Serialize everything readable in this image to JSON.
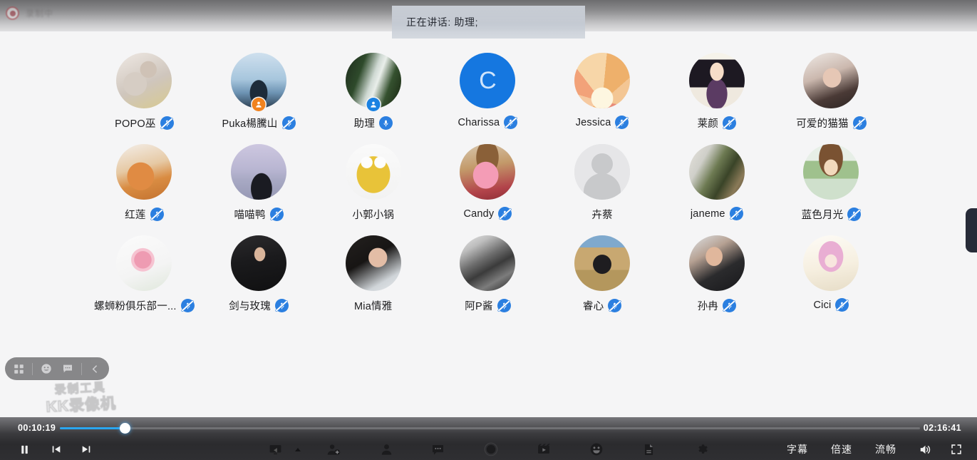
{
  "recording_chip": {
    "label": "录制中",
    "icon": "record-dot-icon"
  },
  "speaking_banner": {
    "text": "正在讲话: 助理;"
  },
  "participants": [
    {
      "name": "POPO巫",
      "mic": "muted",
      "badge": "none",
      "avatar": "cats-photo"
    },
    {
      "name": "Puka楊騰山",
      "mic": "muted",
      "badge": "host",
      "avatar": "water-drop-photo"
    },
    {
      "name": "助理",
      "mic": "on",
      "badge": "me",
      "avatar": "waterfall-photo"
    },
    {
      "name": "Charissa",
      "mic": "muted",
      "badge": "none",
      "avatar": "initial",
      "initial": "C"
    },
    {
      "name": "Jessica",
      "mic": "muted",
      "badge": "none",
      "avatar": "sunburst-art"
    },
    {
      "name": "莱颜",
      "mic": "muted",
      "badge": "none",
      "avatar": "anime-girl-dark-hair"
    },
    {
      "name": "可爱的猫猫",
      "mic": "muted",
      "badge": "none",
      "avatar": "selfie-woman-photo"
    },
    {
      "name": "红莲",
      "mic": "muted",
      "badge": "none",
      "avatar": "orange-cat-antlers"
    },
    {
      "name": "喵喵鸭",
      "mic": "muted",
      "badge": "none",
      "avatar": "person-lilac-sky"
    },
    {
      "name": "小郭小锅",
      "mic": "none",
      "badge": "none",
      "avatar": "yellow-nut-cartoon"
    },
    {
      "name": "Candy",
      "mic": "muted",
      "badge": "none",
      "avatar": "kirby-plush"
    },
    {
      "name": "卉蔡",
      "mic": "none",
      "badge": "none",
      "avatar": "default-silhouette"
    },
    {
      "name": "janeme",
      "mic": "muted",
      "badge": "none",
      "avatar": "street-scene-photo"
    },
    {
      "name": "蓝色月光",
      "mic": "muted",
      "badge": "none",
      "avatar": "anime-girl-brown-hair"
    },
    {
      "name": "螺蛳粉俱乐部一...",
      "mic": "muted",
      "badge": "none",
      "avatar": "pink-rose-photo"
    },
    {
      "name": "剑与玫瑰",
      "mic": "muted",
      "badge": "none",
      "avatar": "dark-portrait-photo"
    },
    {
      "name": "Mia情雅",
      "mic": "none",
      "badge": "none",
      "avatar": "woman-dark-bg-photo"
    },
    {
      "name": "阿P酱",
      "mic": "muted",
      "badge": "none",
      "avatar": "bw-landscape-photo"
    },
    {
      "name": "睿心",
      "mic": "muted",
      "badge": "none",
      "avatar": "woman-field-photo"
    },
    {
      "name": "孙冉",
      "mic": "muted",
      "badge": "none",
      "avatar": "man-portrait-photo"
    },
    {
      "name": "Cici",
      "mic": "muted",
      "badge": "none",
      "avatar": "anime-pink-hair"
    }
  ],
  "float_toolbar": {
    "items": [
      {
        "name": "grid-layout-icon"
      },
      {
        "name": "emoji-reaction-icon"
      },
      {
        "name": "chat-bubble-icon"
      },
      {
        "name": "collapse-chevron-left-icon"
      }
    ]
  },
  "watermark": {
    "line1": "录制工具",
    "line2": "KK录像机"
  },
  "player": {
    "current_time": "00:10:19",
    "total_time": "02:16:41",
    "progress_percent": 7.6,
    "controls_left": [
      {
        "name": "pause-button",
        "icon": "pause-icon"
      },
      {
        "name": "previous-button",
        "icon": "skip-previous-icon"
      },
      {
        "name": "next-button",
        "icon": "skip-next-icon"
      }
    ],
    "controls_center": [
      {
        "name": "screen-share-icon"
      },
      {
        "name": "share-caret-icon"
      },
      {
        "name": "add-participant-icon"
      },
      {
        "name": "participants-icon"
      },
      {
        "name": "chat-icon"
      },
      {
        "name": "record-icon"
      },
      {
        "name": "clapperboard-icon"
      },
      {
        "name": "emoji-icon"
      },
      {
        "name": "document-icon"
      },
      {
        "name": "settings-gear-icon"
      }
    ],
    "controls_right": [
      {
        "name": "subtitles-button",
        "label": "字幕"
      },
      {
        "name": "playback-speed-button",
        "label": "倍速"
      },
      {
        "name": "quality-button",
        "label": "流畅"
      },
      {
        "name": "volume-button",
        "icon": "volume-icon"
      },
      {
        "name": "fullscreen-button",
        "icon": "fullscreen-icon"
      }
    ]
  },
  "colors": {
    "accent_blue": "#2aa6ef",
    "mic_blue": "#2b7fe0",
    "host_orange": "#f0821e",
    "stage_bg": "#f5f5f6"
  }
}
